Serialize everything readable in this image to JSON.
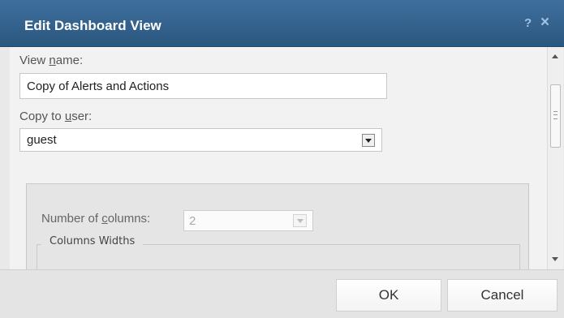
{
  "dialog": {
    "title": "Edit Dashboard View",
    "help_glyph": "?",
    "close_glyph": "×"
  },
  "form": {
    "view_name": {
      "label_pre": "View ",
      "label_mnemonic": "n",
      "label_post": "ame:",
      "value": "Copy of Alerts and Actions"
    },
    "copy_to_user": {
      "label_pre": "Copy to ",
      "label_mnemonic": "u",
      "label_post": "ser:",
      "value": "guest"
    },
    "columns": {
      "label_pre": "Number of ",
      "label_mnemonic": "c",
      "label_post": "olumns:",
      "value": "2",
      "disabled": true
    },
    "widths_legend": "Columns Widths"
  },
  "footer": {
    "ok_label": "OK",
    "cancel_label": "Cancel"
  },
  "colors": {
    "titlebar": "#2f5f8c",
    "title_text": "#ffffff",
    "content_bg": "#f2f2f2",
    "footer_bg": "#e4e4e4"
  },
  "icons": {
    "help": "help-icon",
    "close": "close-icon",
    "dropdown": "chevron-down-icon",
    "scroll_up": "arrow-up-icon",
    "scroll_down": "arrow-down-icon"
  }
}
